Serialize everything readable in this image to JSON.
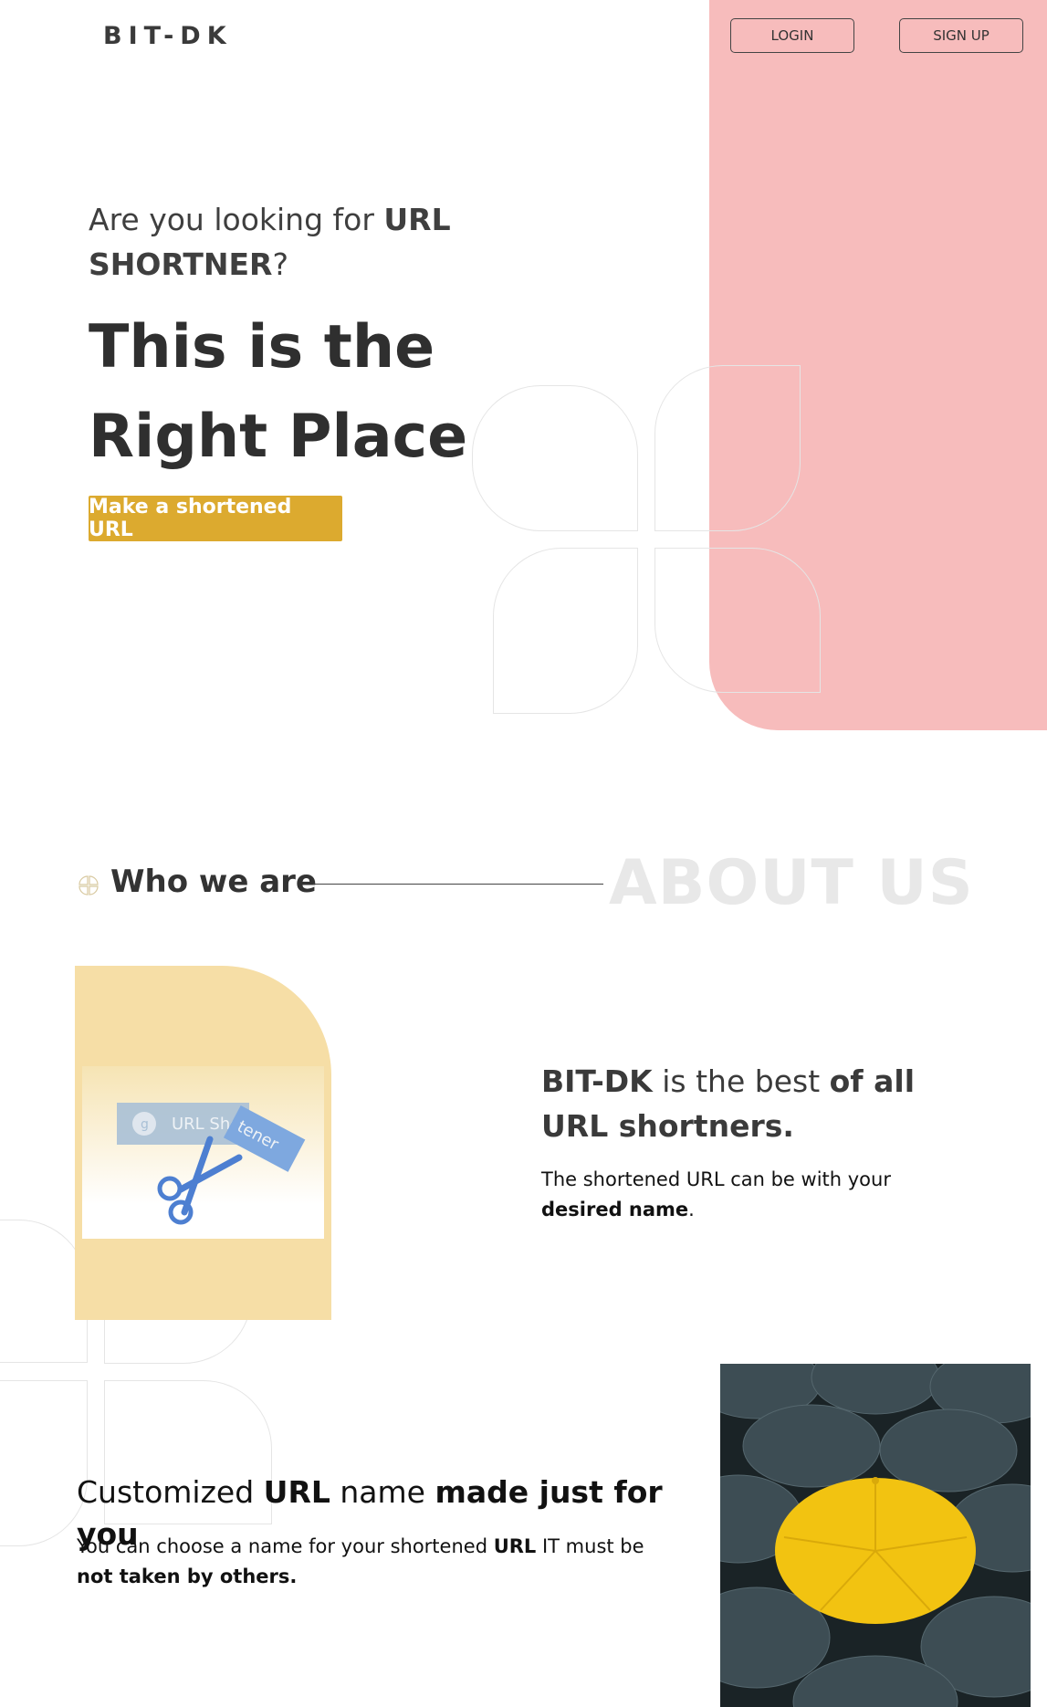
{
  "header": {
    "logo": "BIT-DK",
    "login_label": "LOGIN",
    "signup_label": "SIGN UP"
  },
  "hero": {
    "sub_prefix": "Are you looking for ",
    "sub_bold_1": "URL",
    "sub_bold_2": "SHORTNER",
    "sub_suffix": "?",
    "headline_line1": "This is the",
    "headline_line2": "Right Place",
    "cta_label": "Make a shortened URL"
  },
  "about": {
    "who_label": "Who we are",
    "watermark": "ABOUT US",
    "image_text_1": "URL Shor",
    "image_text_2": "tener",
    "title_bold_1": "BIT-DK",
    "title_mid_1": " is the ",
    "title_mid_2": "best ",
    "title_bold_2": "of all",
    "title_line2": "URL shortners.",
    "desc_prefix": "The shortened URL can be with your ",
    "desc_bold": "desired name",
    "desc_suffix": "."
  },
  "custom": {
    "title_prefix": "Customized ",
    "title_bold_1": "URL",
    "title_mid": " name ",
    "title_bold_2": "made just for you",
    "desc_prefix": "You can choose a name for your shortened ",
    "desc_bold_1": "URL",
    "desc_mid": " IT must be ",
    "desc_bold_2": "not taken by others."
  },
  "colors": {
    "accent": "#dcaa2f",
    "pink": "#f7bcbc",
    "light_yellow": "#f6dea6",
    "umbrella_yellow": "#f2c311"
  }
}
